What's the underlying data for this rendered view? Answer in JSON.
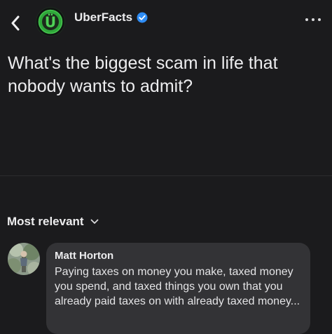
{
  "header": {
    "back_icon": "chevron-left-icon",
    "page_name": "UberFacts",
    "verified_icon": "verified-badge-icon",
    "more_icon": "more-horizontal-icon",
    "logo_letter": "Ü"
  },
  "post": {
    "text": "What's the biggest scam in life that nobody wants to admit?"
  },
  "comments": {
    "sort_label": "Most relevant",
    "items": [
      {
        "author": "Matt Horton",
        "text": "Paying taxes on money you make, taxed money you spend, and taxed things you own that you already paid taxes on with already taxed money..."
      }
    ]
  },
  "colors": {
    "background": "#1b1b1d",
    "brand_green": "#35b43f",
    "verified_blue": "#2f8df5",
    "bubble": "#333336"
  }
}
